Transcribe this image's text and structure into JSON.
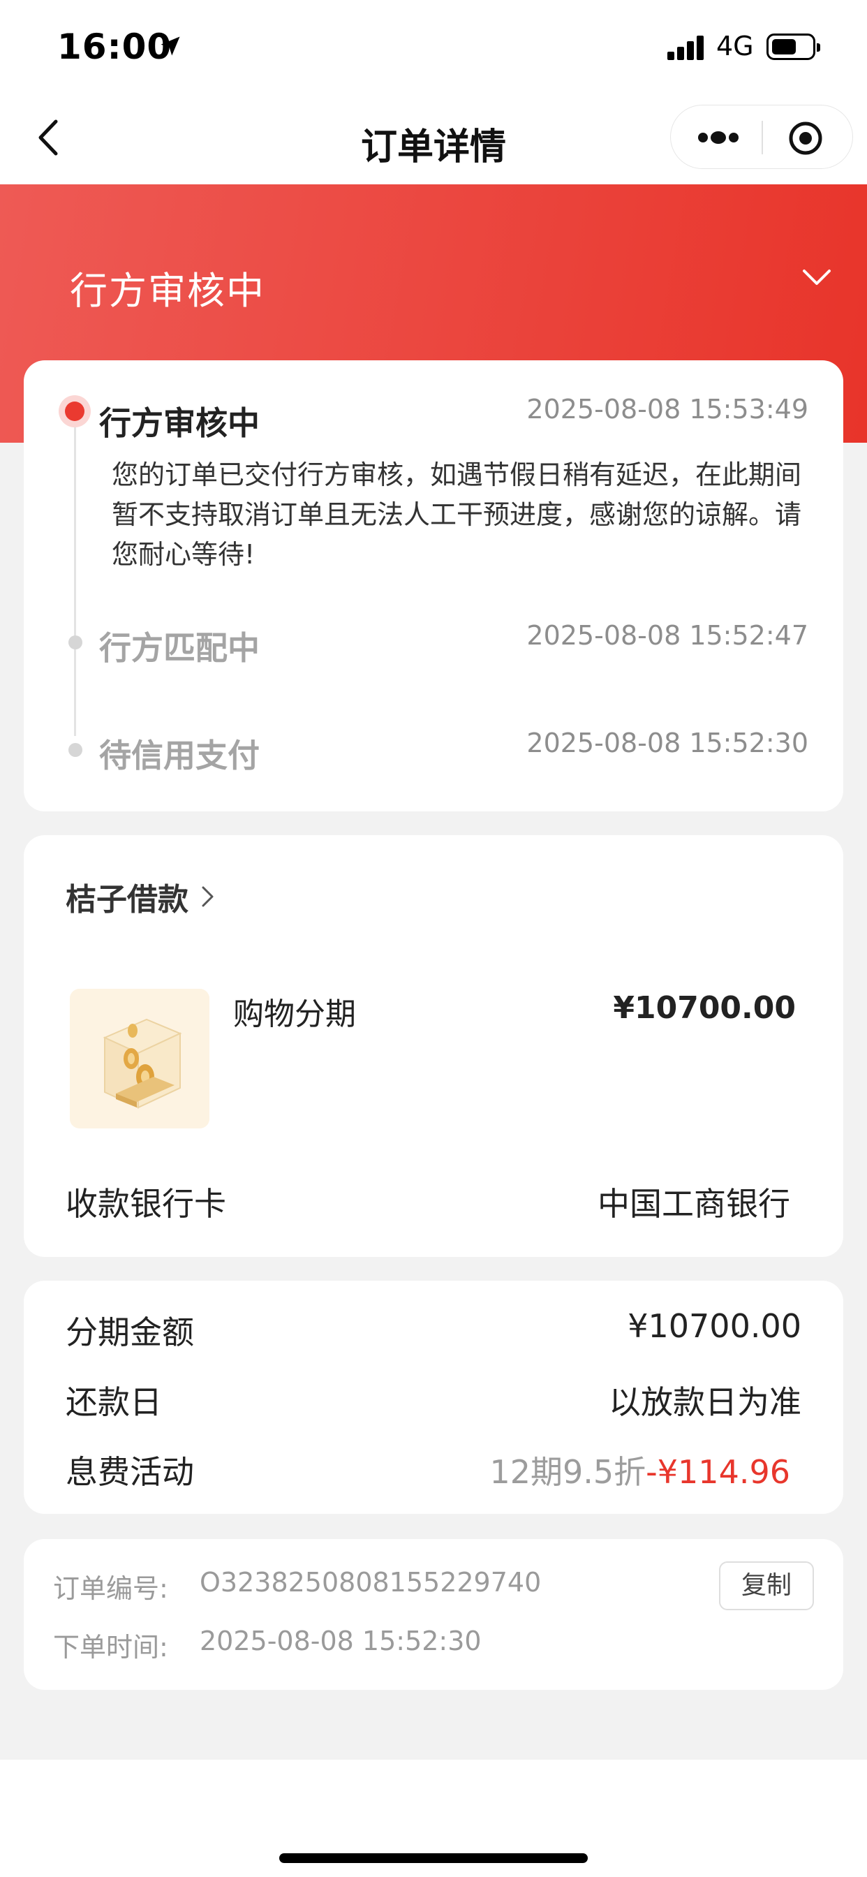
{
  "status_bar": {
    "time": "16:00",
    "network": "4G",
    "battery_level": 0.6
  },
  "nav": {
    "title": "订单详情",
    "back_icon": "chevron-left-icon",
    "more_icon": "more-dots-icon",
    "close_icon": "target-circle-icon"
  },
  "header": {
    "status": "行方审核中",
    "toggle_icon": "chevron-down-icon",
    "color_start": "#ee5a55",
    "color_end": "#e8342a"
  },
  "timeline": [
    {
      "title": "行方审核中",
      "time": "2025-08-08 15:53:49",
      "description": "您的订单已交付行方审核，如遇节假日稍有延迟，在此期间暂不支持取消订单且无法人工干预进度，感谢您的谅解。请您耐心等待!"
    },
    {
      "title": "行方匹配中",
      "time": "2025-08-08 15:52:47"
    },
    {
      "title": "待信用支付",
      "time": "2025-08-08 15:52:30"
    }
  ],
  "product": {
    "merchant": "桔子借款",
    "name": "购物分期",
    "price": "¥10700.00",
    "bank_label": "收款银行卡",
    "bank_value": "中国工商银行"
  },
  "installment": {
    "amount_label": "分期金额",
    "amount_value": "¥10700.00",
    "repay_label": "还款日",
    "repay_value": "以放款日为准",
    "fee_label": "息费活动",
    "fee_plan": "12期9.5折",
    "fee_discount": "-¥114.96",
    "discount_color": "#e8362c"
  },
  "order": {
    "number_label": "订单编号:",
    "number_value": "O3238250808155229740",
    "copy_label": "复制",
    "time_label": "下单时间:",
    "time_value": "2025-08-08 15:52:30"
  }
}
